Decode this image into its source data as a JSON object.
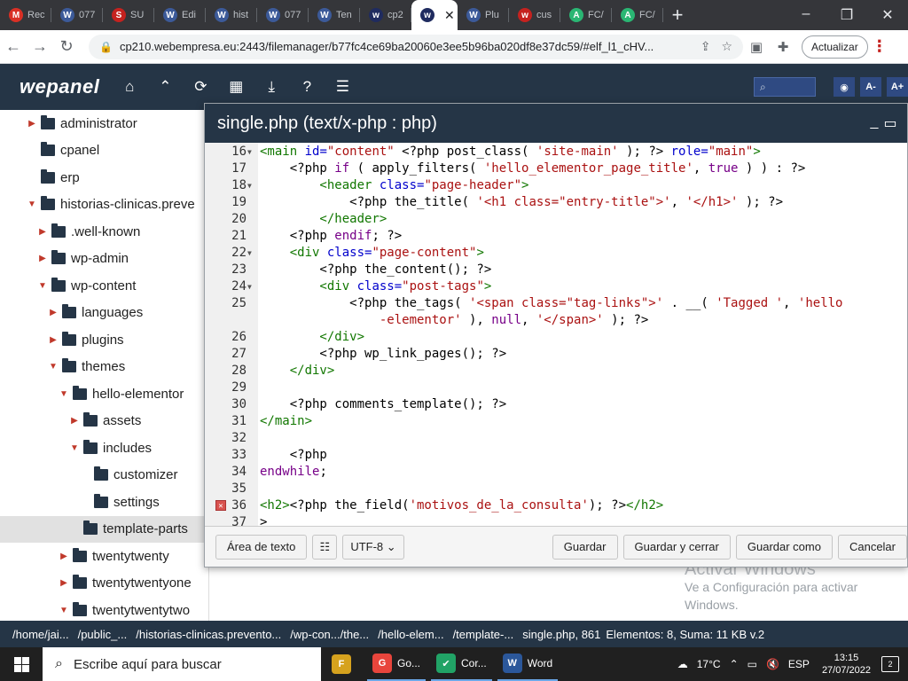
{
  "browser": {
    "tabs": [
      {
        "label": "Rec",
        "color": "#d93025",
        "glyph": "M"
      },
      {
        "label": "077",
        "color": "#3c5a99",
        "glyph": "W"
      },
      {
        "label": "SU",
        "color": "#c5221f",
        "glyph": "S"
      },
      {
        "label": "Edi",
        "color": "#3c5a99",
        "glyph": "W"
      },
      {
        "label": "hist",
        "color": "#3c5a99",
        "glyph": "W"
      },
      {
        "label": "077",
        "color": "#3c5a99",
        "glyph": "W"
      },
      {
        "label": "Ten",
        "color": "#3c5a99",
        "glyph": "W"
      },
      {
        "label": "cp2",
        "color": "#1f2b5f",
        "glyph": "w"
      },
      {
        "label": "",
        "color": "#1f2b5f",
        "glyph": "w",
        "active": true
      },
      {
        "label": "Plu",
        "color": "#3c5a99",
        "glyph": "W"
      },
      {
        "label": "cus",
        "color": "#c5221f",
        "glyph": "w"
      },
      {
        "label": "FC/",
        "color": "#2ab673",
        "glyph": "A"
      },
      {
        "label": "FC/",
        "color": "#2ab673",
        "glyph": "A"
      }
    ],
    "url": "cp210.webempresa.eu:2443/filemanager/b77fc4ce69ba20060e3ee5b96ba020df8e37dc59/#elf_l1_cHV...",
    "update_label": "Actualizar"
  },
  "wepanel": {
    "logo": "wepanel",
    "search_placeholder": "",
    "zoom_minus": "A-",
    "zoom_plus": "A+"
  },
  "tree": {
    "items": [
      {
        "label": "administrator",
        "depth": 0,
        "arrow": "right"
      },
      {
        "label": "cpanel",
        "depth": 0,
        "arrow": ""
      },
      {
        "label": "erp",
        "depth": 0,
        "arrow": ""
      },
      {
        "label": "historias-clinicas.preve",
        "depth": 0,
        "arrow": "down"
      },
      {
        "label": ".well-known",
        "depth": 1,
        "arrow": "right"
      },
      {
        "label": "wp-admin",
        "depth": 1,
        "arrow": "right"
      },
      {
        "label": "wp-content",
        "depth": 1,
        "arrow": "down"
      },
      {
        "label": "languages",
        "depth": 2,
        "arrow": "right"
      },
      {
        "label": "plugins",
        "depth": 2,
        "arrow": "right"
      },
      {
        "label": "themes",
        "depth": 2,
        "arrow": "down"
      },
      {
        "label": "hello-elementor",
        "depth": 3,
        "arrow": "down"
      },
      {
        "label": "assets",
        "depth": 4,
        "arrow": "right"
      },
      {
        "label": "includes",
        "depth": 4,
        "arrow": "down"
      },
      {
        "label": "customizer",
        "depth": 5,
        "arrow": ""
      },
      {
        "label": "settings",
        "depth": 5,
        "arrow": ""
      },
      {
        "label": "template-parts",
        "depth": 4,
        "arrow": "",
        "selected": true,
        "open": true
      },
      {
        "label": "twentytwenty",
        "depth": 3,
        "arrow": "right"
      },
      {
        "label": "twentytwentyone",
        "depth": 3,
        "arrow": "right"
      },
      {
        "label": "twentytwentytwo",
        "depth": 3,
        "arrow": "down"
      }
    ]
  },
  "editor": {
    "title": "single.php (text/x-php : php)",
    "lines": [
      {
        "num": "16",
        "fold": true,
        "segs": [
          [
            "t",
            "<main"
          ],
          [
            "a",
            " id="
          ],
          [
            "s",
            "\"content\""
          ],
          [
            "p",
            " <?php post_class( "
          ],
          [
            "s",
            "'site-main'"
          ],
          [
            "p",
            " ); ?>"
          ],
          [
            "a",
            " role="
          ],
          [
            "s",
            "\"main\""
          ],
          [
            "t",
            ">"
          ]
        ]
      },
      {
        "num": "17",
        "segs": [
          [
            "p",
            "    <?php "
          ],
          [
            "k",
            "if"
          ],
          [
            "p",
            " ( apply_filters( "
          ],
          [
            "s",
            "'hello_elementor_page_title'"
          ],
          [
            "p",
            ", "
          ],
          [
            "k",
            "true"
          ],
          [
            "p",
            " ) ) : ?>"
          ]
        ]
      },
      {
        "num": "18",
        "fold": true,
        "segs": [
          [
            "t",
            "        <header"
          ],
          [
            "a",
            " class="
          ],
          [
            "s",
            "\"page-header\""
          ],
          [
            "t",
            ">"
          ]
        ]
      },
      {
        "num": "19",
        "segs": [
          [
            "p",
            "            <?php the_title( "
          ],
          [
            "s",
            "'<h1 class=\"entry-title\">'"
          ],
          [
            "p",
            ", "
          ],
          [
            "s",
            "'</h1>'"
          ],
          [
            "p",
            " ); ?>"
          ]
        ]
      },
      {
        "num": "20",
        "segs": [
          [
            "t",
            "        </header>"
          ]
        ]
      },
      {
        "num": "21",
        "segs": [
          [
            "p",
            "    <?php "
          ],
          [
            "k",
            "endif"
          ],
          [
            "p",
            "; ?>"
          ]
        ]
      },
      {
        "num": "22",
        "fold": true,
        "segs": [
          [
            "t",
            "    <div"
          ],
          [
            "a",
            " class="
          ],
          [
            "s",
            "\"page-content\""
          ],
          [
            "t",
            ">"
          ]
        ]
      },
      {
        "num": "23",
        "segs": [
          [
            "p",
            "        <?php the_content(); ?>"
          ]
        ]
      },
      {
        "num": "24",
        "fold": true,
        "segs": [
          [
            "t",
            "        <div"
          ],
          [
            "a",
            " class="
          ],
          [
            "s",
            "\"post-tags\""
          ],
          [
            "t",
            ">"
          ]
        ]
      },
      {
        "num": "25",
        "segs": [
          [
            "p",
            "            <?php the_tags( "
          ],
          [
            "s",
            "'<span class=\"tag-links\">'"
          ],
          [
            "p",
            " . __( "
          ],
          [
            "s",
            "'Tagged '"
          ],
          [
            "p",
            ", "
          ],
          [
            "s",
            "'hello"
          ]
        ]
      },
      {
        "num": "",
        "segs": [
          [
            "s",
            "                -elementor'"
          ],
          [
            "p",
            " ), "
          ],
          [
            "k",
            "null"
          ],
          [
            "p",
            ", "
          ],
          [
            "s",
            "'</span>'"
          ],
          [
            "p",
            " ); ?>"
          ]
        ]
      },
      {
        "num": "26",
        "segs": [
          [
            "t",
            "        </div>"
          ]
        ]
      },
      {
        "num": "27",
        "segs": [
          [
            "p",
            "        <?php wp_link_pages(); ?>"
          ]
        ]
      },
      {
        "num": "28",
        "segs": [
          [
            "t",
            "    </div>"
          ]
        ]
      },
      {
        "num": "29",
        "segs": [
          [
            "p",
            ""
          ]
        ]
      },
      {
        "num": "30",
        "segs": [
          [
            "p",
            "    <?php comments_template(); ?>"
          ]
        ]
      },
      {
        "num": "31",
        "segs": [
          [
            "t",
            "</main>"
          ]
        ]
      },
      {
        "num": "32",
        "segs": [
          [
            "p",
            ""
          ]
        ]
      },
      {
        "num": "33",
        "segs": [
          [
            "p",
            "    <?php"
          ]
        ]
      },
      {
        "num": "34",
        "segs": [
          [
            "k",
            "endwhile"
          ],
          [
            "p",
            ";"
          ]
        ]
      },
      {
        "num": "35",
        "segs": [
          [
            "p",
            ""
          ]
        ]
      },
      {
        "num": "36",
        "error": true,
        "segs": [
          [
            "t",
            "<h2>"
          ],
          [
            "p",
            "<?php the_field("
          ],
          [
            "s",
            "'motivos_de_la_consulta'"
          ],
          [
            "p",
            "); ?>"
          ],
          [
            "t",
            "</h2>"
          ]
        ]
      },
      {
        "num": "37",
        "segs": [
          [
            "p",
            ">"
          ]
        ]
      }
    ],
    "footer": {
      "textarea_label": "Área de texto",
      "encoding": "UTF-8",
      "save_label": "Guardar",
      "save_close_label": "Guardar y cerrar",
      "save_as_label": "Guardar como",
      "cancel_label": "Cancelar"
    }
  },
  "watermark": {
    "line1": "Activar Windows",
    "line2": "Ve a Configuración para activar",
    "line3": "Windows."
  },
  "statusbar": {
    "crumbs": [
      "/home/jai...",
      "/public_...",
      "/historias-clinicas.prevento...",
      "/wp-con.../the...",
      "/hello-elem...",
      "/template-..."
    ],
    "file": "single.php, 861",
    "info": "Elementos: 8, Suma: 11 KB v.2"
  },
  "taskbar": {
    "search_placeholder": "Escribe aquí para buscar",
    "apps": [
      {
        "label": "",
        "color": "#d6a21e",
        "glyph": "F"
      },
      {
        "label": "Go...",
        "color": "#e8453c",
        "glyph": "G"
      },
      {
        "label": "Cor...",
        "color": "#21a366",
        "glyph": "✔"
      },
      {
        "label": "Word",
        "color": "#2b579a",
        "glyph": "W"
      }
    ],
    "weather": "17°C",
    "lang": "ESP",
    "time": "13:15",
    "date": "27/07/2022",
    "notifications": "2"
  },
  "colors": {
    "tag": "#170",
    "attr": "#00c",
    "string": "#a11",
    "keyword": "#708",
    "php": "#000",
    "panel": "#253546"
  }
}
